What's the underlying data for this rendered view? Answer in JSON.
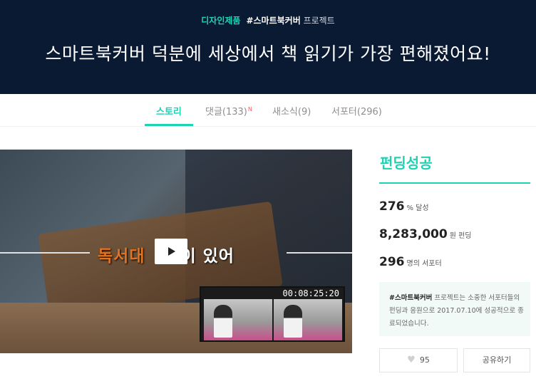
{
  "banner": {
    "category": "디자인제품",
    "tag": "#스마트북커버",
    "tag_suffix": " 프로젝트",
    "title": "스마트북커버 덕분에 세상에서 책 읽기가 가장 편해졌어요!"
  },
  "tabs": [
    {
      "label": "스토리",
      "active": true
    },
    {
      "label": "댓글(133)",
      "badge": "N"
    },
    {
      "label": "새소식(9)"
    },
    {
      "label": "서포터(296)"
    }
  ],
  "video": {
    "caption_left": "독서대",
    "caption_right": "이 있어",
    "timestamp": "00:08:25:20",
    "play_icon": "play-icon"
  },
  "panel": {
    "status": "펀딩성공",
    "percent": "276",
    "percent_unit": "% 달성",
    "amount": "8,283,000",
    "amount_unit": "원 펀딩",
    "supporters": "296",
    "supporters_unit": "명의 서포터",
    "notice_tag": "#스마트북커버",
    "notice_text": " 프로젝트는 소중한 서포터들의 펀딩과 응원으로 2017.07.10에 성공적으로 종료되었습니다.",
    "like_count": "95",
    "share_label": "공유하기"
  },
  "colors": {
    "accent": "#1ed2b4",
    "banner_bg": "#0b1a33",
    "caption_orange": "#e3731f"
  }
}
